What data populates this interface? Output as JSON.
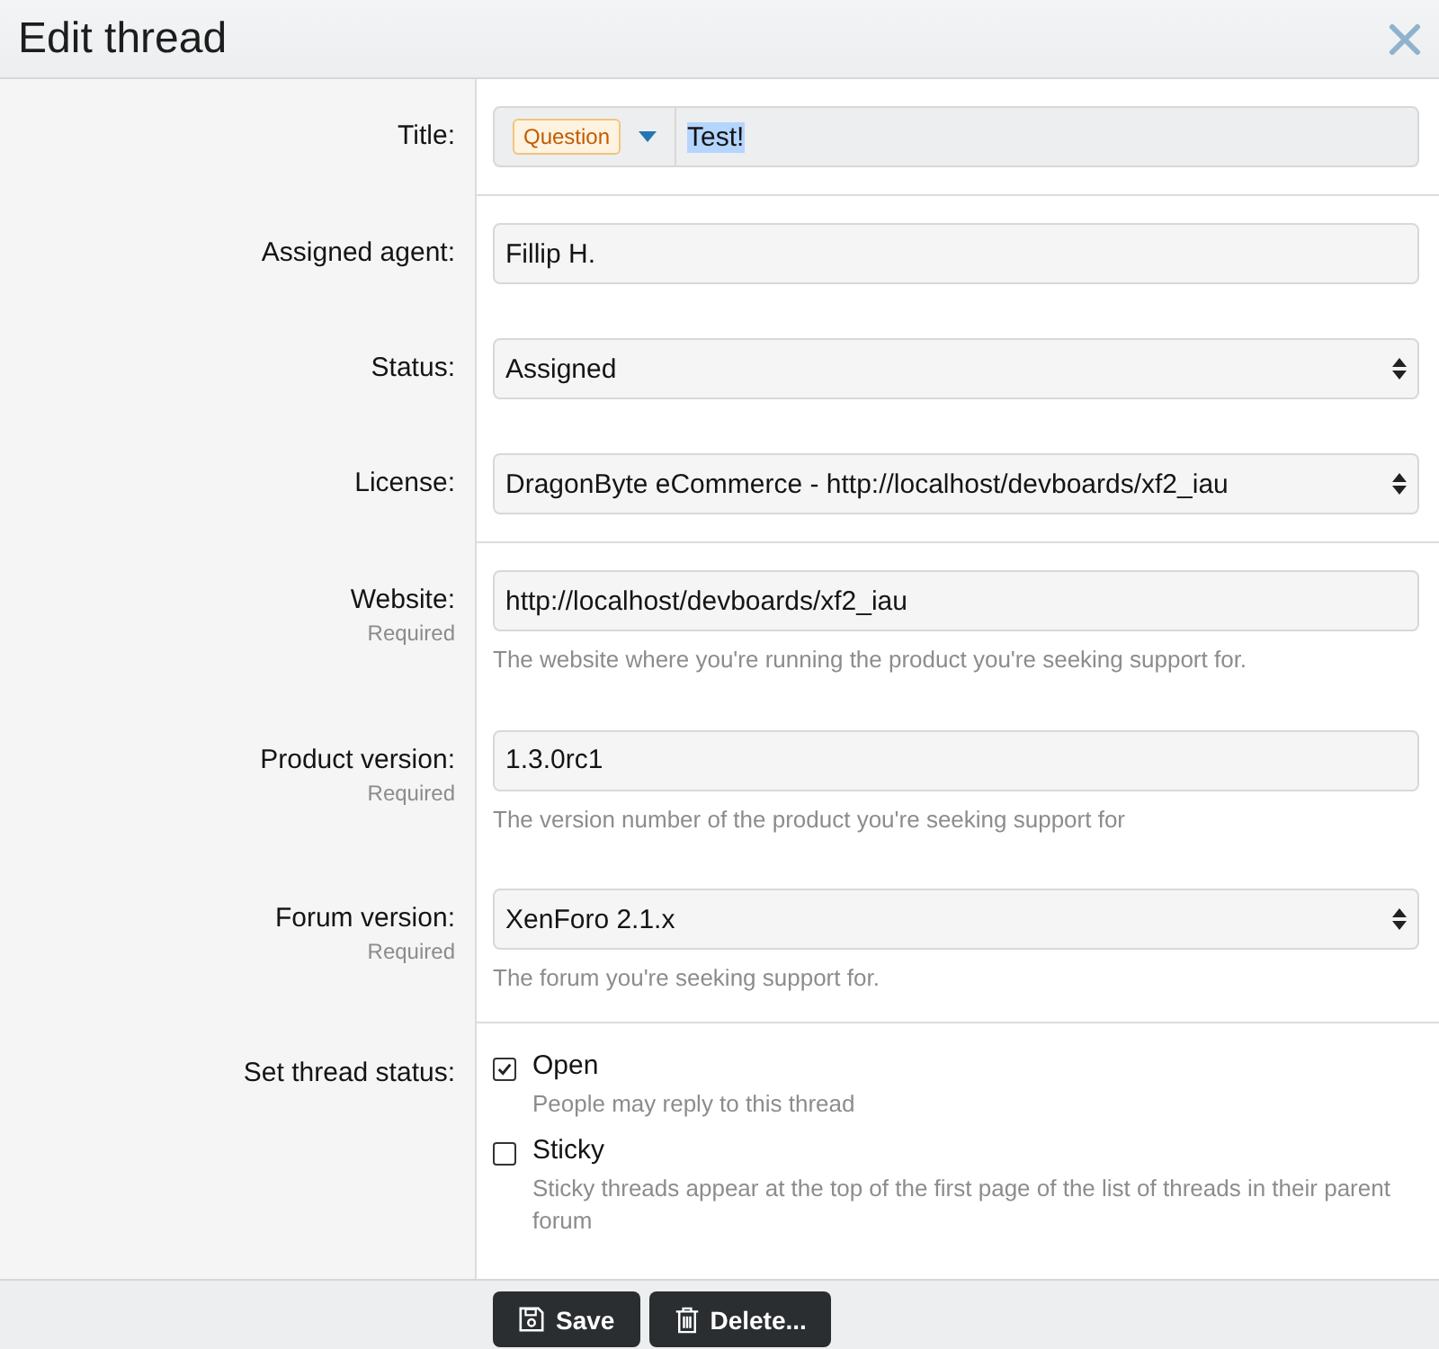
{
  "dialog": {
    "title": "Edit thread"
  },
  "sections": [
    {
      "rows": [
        {
          "kind": "title",
          "label": "Title:",
          "prefix": "Question",
          "value": "Test!",
          "value_selected": true
        }
      ]
    },
    {
      "rows": [
        {
          "kind": "text",
          "label": "Assigned agent:",
          "value": "Fillip H."
        },
        {
          "kind": "select",
          "label": "Status:",
          "value": "Assigned"
        },
        {
          "kind": "select",
          "label": "License:",
          "value": "DragonByte eCommerce - http://localhost/devboards/xf2_iau"
        }
      ]
    },
    {
      "rows": [
        {
          "kind": "text",
          "label": "Website:",
          "required": "Required",
          "value": "http://localhost/devboards/xf2_iau",
          "hint": "The website where you're running the product you're seeking support for."
        },
        {
          "kind": "text",
          "label": "Product version:",
          "required": "Required",
          "value": "1.3.0rc1",
          "hint": "The version number of the product you're seeking support for"
        },
        {
          "kind": "select",
          "label": "Forum version:",
          "required": "Required",
          "value": "XenForo 2.1.x",
          "hint": "The forum you're seeking support for."
        }
      ]
    },
    {
      "rows": [
        {
          "kind": "checkboxes",
          "label": "Set thread status:",
          "options": [
            {
              "label": "Open",
              "hint": "People may reply to this thread",
              "checked": true
            },
            {
              "label": "Sticky",
              "hint": "Sticky threads appear at the top of the first page of the list of threads in their parent forum",
              "checked": false
            }
          ]
        }
      ]
    }
  ],
  "buttons": [
    {
      "kind": "save",
      "label": "Save"
    },
    {
      "kind": "delete",
      "label": "Delete..."
    }
  ]
}
